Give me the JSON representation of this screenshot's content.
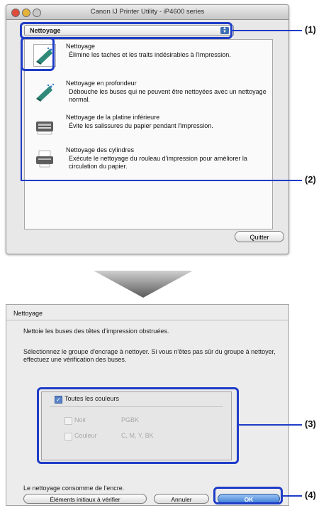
{
  "window": {
    "title": "Canon IJ Printer Utility - iP4600 series",
    "popup_value": "Nettoyage",
    "items": [
      {
        "title": "Nettoyage",
        "desc": "Élimine les taches et les traits indésirables à l'impression.",
        "icon": "print-head-cleaning-icon"
      },
      {
        "title": "Nettoyage en profondeur",
        "desc": "Débouche les buses qui ne peuvent être nettoyées avec un nettoyage normal.",
        "icon": "deep-cleaning-icon"
      },
      {
        "title": "Nettoyage de la platine inférieure",
        "desc": "Évite les salissures du papier pendant l'impression.",
        "icon": "bottom-plate-cleaning-icon"
      },
      {
        "title": "Nettoyage des cylindres",
        "desc": "Exécute le nettoyage du rouleau d'impression pour améliorer la circulation du papier.",
        "icon": "roller-cleaning-icon"
      }
    ],
    "quit_label": "Quitter"
  },
  "dialog": {
    "title": "Nettoyage",
    "text1": "Nettoie les buses des têtes d'impression obstruées.",
    "text2": "Sélectionnez le groupe d'encrage à nettoyer. Si vous n'êtes pas sûr du groupe à nettoyer, effectuez une vérification des buses.",
    "group": {
      "all_label": "Toutes les couleurs",
      "all_checked": true,
      "black_label": "Noir",
      "black_value": "PGBK",
      "color_label": "Couleur",
      "color_value": "C, M, Y, BK"
    },
    "note": "Le nettoyage consomme de l'encre.",
    "btn_check": "Éléments initiaux à vérifier",
    "btn_cancel": "Annuler",
    "btn_ok": "OK"
  },
  "callouts": [
    "(1)",
    "(2)",
    "(3)",
    "(4)"
  ],
  "colors": {
    "callout": "#1f3cc7",
    "ok_button": "#3d7fd6"
  }
}
